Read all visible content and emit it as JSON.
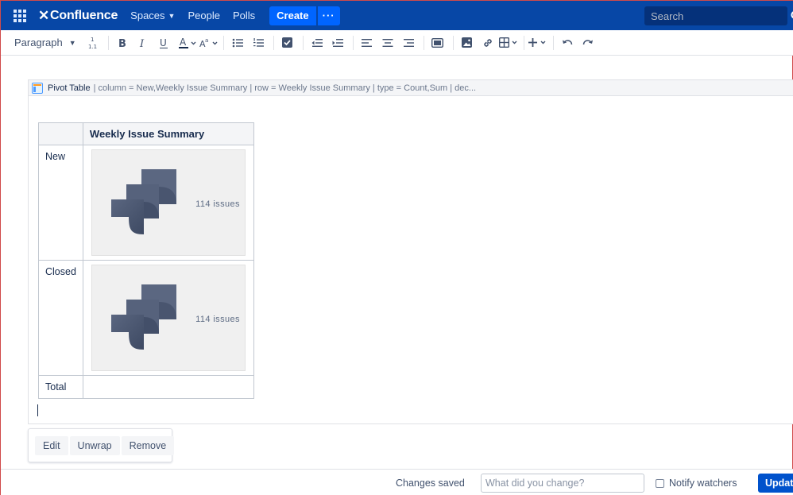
{
  "nav": {
    "logo": "Confluence",
    "spaces": "Spaces",
    "people": "People",
    "polls": "Polls",
    "create": "Create",
    "more": "···",
    "search_placeholder": "Search"
  },
  "toolbar": {
    "paragraph": "Paragraph"
  },
  "macro": {
    "name": "Pivot Table",
    "params": "| column = New,Weekly Issue Summary | row = Weekly Issue Summary | type = Count,Sum | dec..."
  },
  "pivot": {
    "header": "Weekly Issue Summary",
    "rows": [
      {
        "label": "New",
        "count": "114 issues"
      },
      {
        "label": "Closed",
        "count": "114 issues"
      },
      {
        "label": "Total"
      }
    ]
  },
  "macro_actions": {
    "edit": "Edit",
    "unwrap": "Unwrap",
    "remove": "Remove"
  },
  "footer": {
    "status": "Changes saved",
    "comment_placeholder": "What did you change?",
    "notify": "Notify watchers",
    "update": "Update"
  },
  "colors": {
    "nav_bg": "#0747a6",
    "primary": "#0065ff",
    "update_button": "#0052cc"
  }
}
